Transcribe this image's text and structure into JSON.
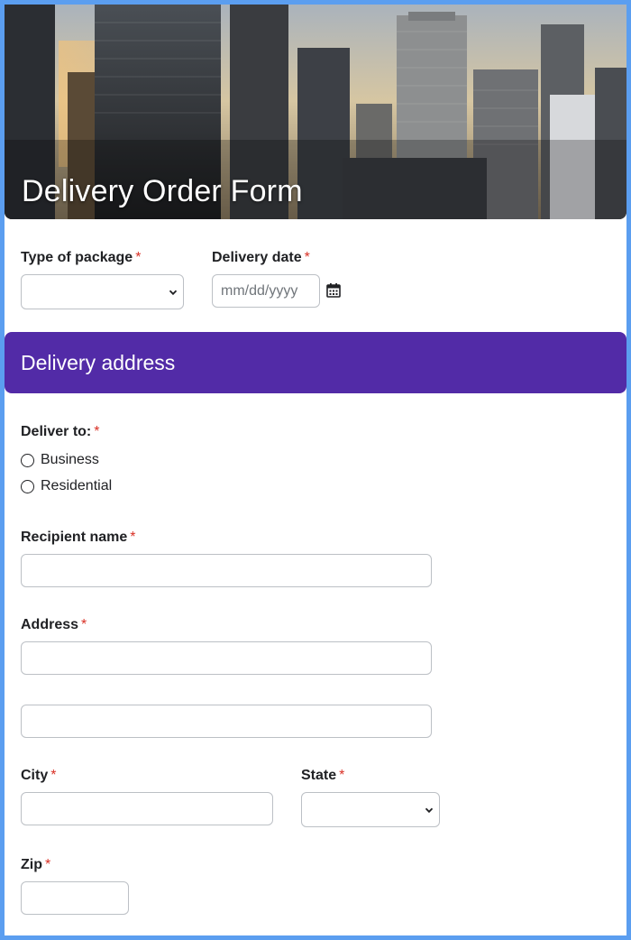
{
  "header": {
    "title": "Delivery Order Form"
  },
  "fields": {
    "package_type": {
      "label": "Type of package",
      "required_mark": "*"
    },
    "delivery_date": {
      "label": "Delivery date",
      "required_mark": "*",
      "placeholder": "mm/dd/yyyy"
    },
    "deliver_to": {
      "label": "Deliver to:",
      "required_mark": "*",
      "options": [
        "Business",
        "Residential"
      ]
    },
    "recipient_name": {
      "label": "Recipient name",
      "required_mark": "*"
    },
    "address": {
      "label": "Address",
      "required_mark": "*"
    },
    "city": {
      "label": "City",
      "required_mark": "*"
    },
    "state": {
      "label": "State",
      "required_mark": "*"
    },
    "zip": {
      "label": "Zip",
      "required_mark": "*"
    }
  },
  "section": {
    "title": "Delivery address"
  },
  "colors": {
    "page_border": "#5b9ef0",
    "section_bg": "#522ba7",
    "required": "#d93025"
  }
}
